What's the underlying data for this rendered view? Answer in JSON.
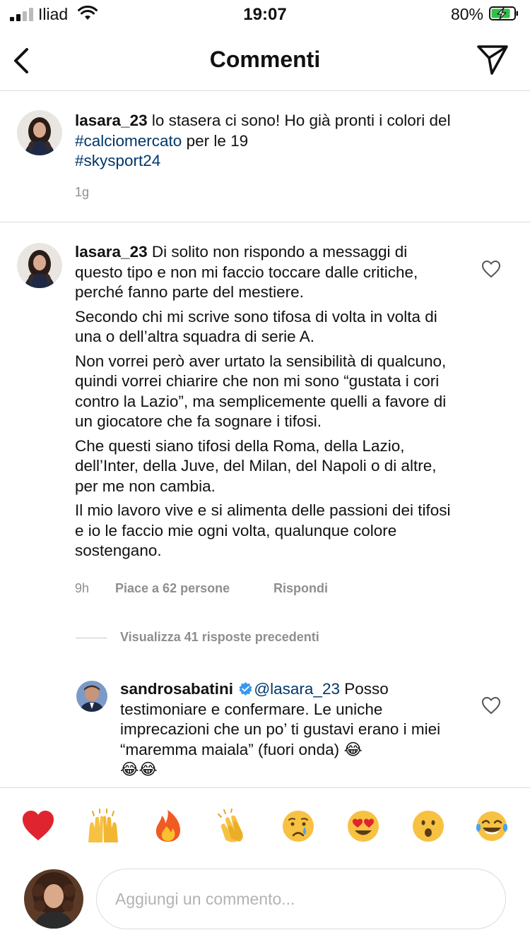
{
  "status_bar": {
    "carrier": "Iliad",
    "time": "19:07",
    "battery_pct": "80%"
  },
  "header": {
    "title": "Commenti",
    "back_icon": "chevron-left-icon",
    "send_icon": "paper-plane-icon"
  },
  "caption": {
    "username": "lasara_23",
    "text_1": " lo stasera ci sono! Ho già pronti i colori del",
    "hashtag_1": "#calciomercato",
    "text_2": " per le 19",
    "hashtag_2": "#skysport24",
    "time": "1g"
  },
  "comment": {
    "username": "lasara_23",
    "p1": " Di solito non rispondo a messaggi di questo tipo e non mi faccio toccare dalle critiche, perché fanno parte del mestiere.",
    "p2": "Secondo chi mi scrive sono tifosa di volta in volta di una o dell’altra squadra di serie A.",
    "p3": "Non vorrei però aver urtato la sensibilità di qualcuno, quindi vorrei chiarire che non mi sono “gustata i cori contro la Lazio”, ma semplicemente quelli a favore di un giocatore che fa sognare i tifosi.",
    "p4": "Che questi siano tifosi della Roma, della Lazio, dell’Inter, della Juve, del Milan, del Napoli o di altre, per me non cambia.",
    "p5": "Il mio lavoro vive e si alimenta delle passioni dei tifosi e io le faccio mie ogni volta, qualunque colore sostengano.",
    "time": "9h",
    "likes": "Piace a 62 persone",
    "reply": "Rispondi"
  },
  "view_replies": "Visualizza 41 risposte precedenti",
  "reply": {
    "username": "sandrosabatini",
    "verified_icon": "verified-badge-icon",
    "mention": "@lasara_23",
    "text": " Posso testimoniare e confermare. Le uniche imprecazioni che un po’ ti gustavi erano i miei “maremma maiala” (fuori onda) ",
    "emoji_tail_1": "😂",
    "emoji_tail_2": "😂😂"
  },
  "reactions": [
    "red-heart-icon",
    "raised-hands-icon",
    "fire-icon",
    "clapping-hands-icon",
    "crying-face-icon",
    "heart-eyes-icon",
    "surprised-face-icon",
    "tears-of-joy-icon"
  ],
  "composer": {
    "placeholder": "Aggiungi un commento..."
  },
  "colors": {
    "link": "#00376b",
    "verified": "#3897f0",
    "muted": "#8e8e8e",
    "divider": "#dbdbdb",
    "heart_reaction": "#e0242f"
  }
}
